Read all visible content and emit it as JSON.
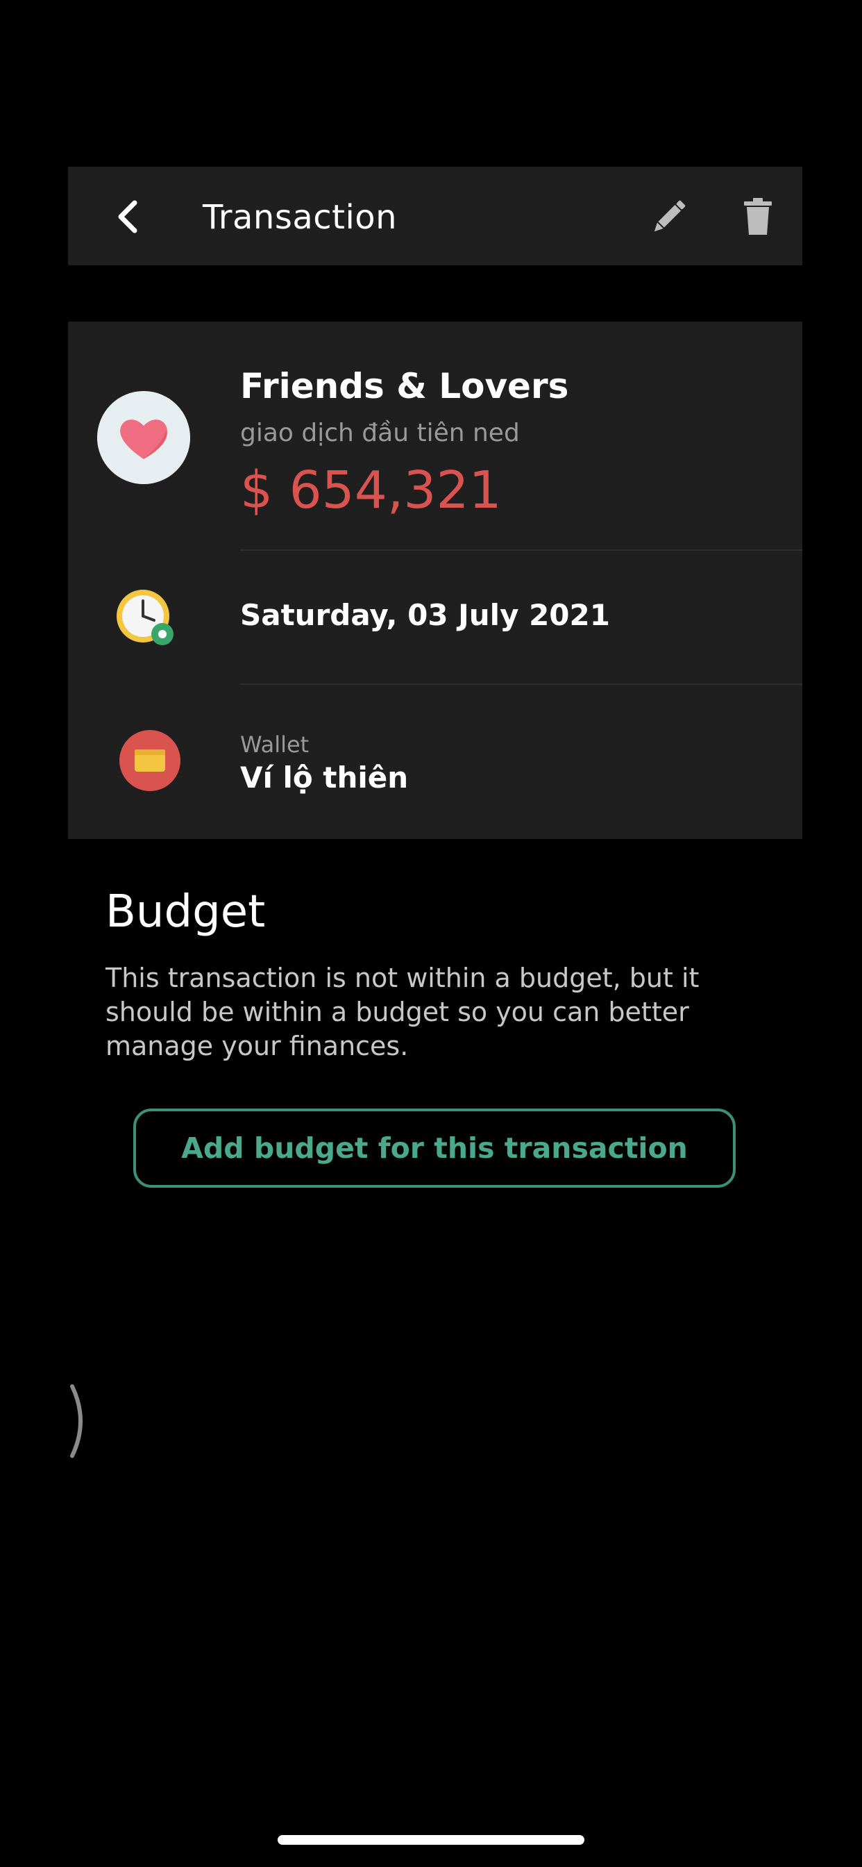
{
  "header": {
    "title": "Transaction"
  },
  "transaction": {
    "category": "Friends & Lovers",
    "note": "giao dịch đầu tiên ned",
    "amount": "$ 654,321",
    "date": "Saturday, 03 July 2021",
    "wallet_label": "Wallet",
    "wallet_name": "Ví lộ thiên"
  },
  "budget": {
    "title": "Budget",
    "description": "This transaction is not within a budget, but it should be within a budget so you can better manage your finances.",
    "button_label": "Add budget for this transaction"
  },
  "icons": {
    "back": "chevron-left-icon",
    "edit": "pencil-icon",
    "delete": "trash-icon",
    "category": "heart-icon",
    "date": "clock-icon",
    "wallet": "wallet-icon"
  },
  "colors": {
    "amount": "#d9534f",
    "accent": "#4aa88c",
    "card_bg": "#1f1f1f"
  }
}
